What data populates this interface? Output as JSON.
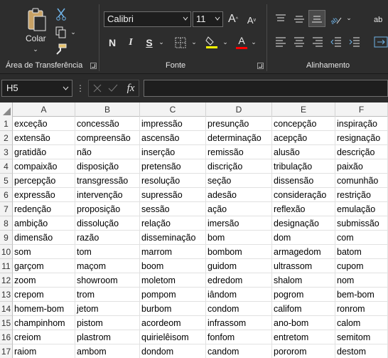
{
  "ribbon": {
    "clipboard": {
      "paste_label": "Colar",
      "group_label": "Área de Transferência"
    },
    "font": {
      "name": "Calibri",
      "size": "11",
      "group_label": "Fonte",
      "bold": "N",
      "italic": "I",
      "underline": "S",
      "grow": "A",
      "shrink": "A",
      "font_color_letter": "A"
    },
    "alignment": {
      "group_label": "Alinhamento",
      "wrap_partial": "ab"
    },
    "colors": {
      "highlight": "#ffff00",
      "font_color": "#ff0000",
      "accent": "#217346"
    }
  },
  "formula_bar": {
    "name_box": "H5",
    "fx": "fx",
    "formula": ""
  },
  "sheet": {
    "columns": [
      "A",
      "B",
      "C",
      "D",
      "E",
      "F"
    ],
    "rows": [
      {
        "n": "1",
        "cells": [
          "exceção",
          "concessão",
          "impressão",
          "presunção",
          "concepção",
          "inspiração"
        ]
      },
      {
        "n": "2",
        "cells": [
          "extensão",
          "compreensão",
          "ascensão",
          "determinação",
          "acepção",
          "resignação"
        ]
      },
      {
        "n": "3",
        "cells": [
          "gratidão",
          "não",
          "inserção",
          "remissão",
          "alusão",
          "descrição"
        ]
      },
      {
        "n": "4",
        "cells": [
          "compaixão",
          "disposição",
          "pretensão",
          "discrição",
          "tribulação",
          "paixão"
        ]
      },
      {
        "n": "5",
        "cells": [
          "percepção",
          "transgressão",
          "resolução",
          "seção",
          "dissensão",
          "comunhão"
        ]
      },
      {
        "n": "6",
        "cells": [
          "expressão",
          "intervenção",
          "supressão",
          "adesão",
          "consideração",
          "restrição"
        ]
      },
      {
        "n": "7",
        "cells": [
          "redenção",
          "proposição",
          "sessão",
          "ação",
          "reflexão",
          "emulação"
        ]
      },
      {
        "n": "8",
        "cells": [
          "ambição",
          "dissolução",
          "relação",
          "imersão",
          "designação",
          "submissão"
        ]
      },
      {
        "n": "9",
        "cells": [
          "dimensão",
          "razão",
          "disseminação",
          "bom",
          "dom",
          "com"
        ]
      },
      {
        "n": "10",
        "cells": [
          "som",
          "tom",
          "marrom",
          "bombom",
          "armagedom",
          "batom"
        ]
      },
      {
        "n": "11",
        "cells": [
          "garçom",
          "maçom",
          "boom",
          "guidom",
          "ultrassom",
          "cupom"
        ]
      },
      {
        "n": "12",
        "cells": [
          "zoom",
          "showroom",
          "moletom",
          "edredom",
          "shalom",
          "nom"
        ]
      },
      {
        "n": "13",
        "cells": [
          "crepom",
          "trom",
          "pompom",
          "iândom",
          "pogrom",
          "bem-bom"
        ]
      },
      {
        "n": "14",
        "cells": [
          "homem-bom",
          "jetom",
          "burbom",
          "condom",
          "califom",
          "ronrom"
        ]
      },
      {
        "n": "15",
        "cells": [
          "champinhom",
          "pistom",
          "acordeom",
          "infrassom",
          "ano-bom",
          "calom"
        ]
      },
      {
        "n": "16",
        "cells": [
          "creiom",
          "plastrom",
          "quirielêisom",
          "fonfom",
          "entretom",
          "semitom"
        ]
      },
      {
        "n": "17",
        "cells": [
          "raiom",
          "ambom",
          "dondom",
          "candom",
          "pororom",
          "destom"
        ]
      }
    ]
  }
}
